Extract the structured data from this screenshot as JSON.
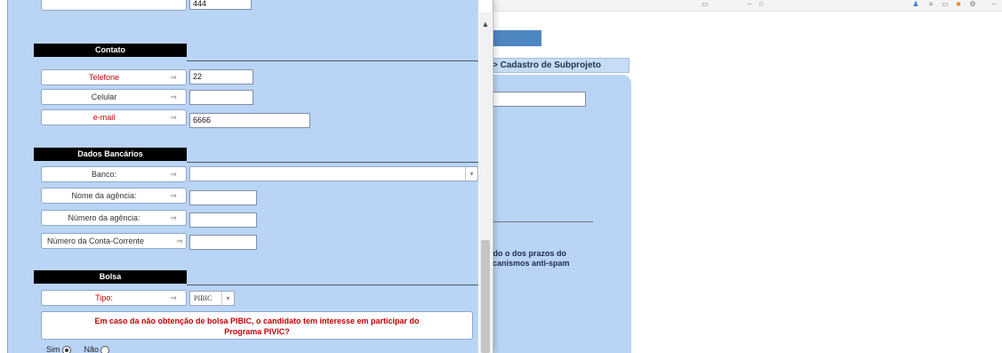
{
  "top_field": {
    "value": "444"
  },
  "contato": {
    "heading": "Contato",
    "fields": [
      {
        "label": "Telefone",
        "arrow": "⇒",
        "value": "22"
      },
      {
        "label": "Celular",
        "arrow": "⇒",
        "value": ""
      },
      {
        "label": "e-mail",
        "arrow": "⇒",
        "value": "6666"
      }
    ]
  },
  "dados_bancarios": {
    "heading": "Dados Bancários",
    "banco": {
      "label": "Banco:",
      "arrow": "⇒",
      "value": ""
    },
    "fields": [
      {
        "label": "Nome da agência:",
        "arrow": "⇒",
        "value": ""
      },
      {
        "label": "Número da agência:",
        "arrow": "⇒",
        "value": ""
      },
      {
        "label": "Número da Conta-Corrente",
        "arrow": "⇒",
        "value": ""
      }
    ]
  },
  "bolsa": {
    "heading": "Bolsa",
    "tipo": {
      "label": "Tipo:",
      "arrow": "⇒",
      "value": "PIBIC"
    },
    "question_line1": "Em caso da não obtenção de bolsa PIBIC, o candidato tem interesse em participar do",
    "question_line2": "Programa PIVIC?",
    "radio_options": [
      {
        "label": "Sim",
        "selected": true
      },
      {
        "label": "Não",
        "selected": false
      }
    ]
  },
  "background_page": {
    "breadcrumb": "> Cadastro de Subprojeto",
    "notice_line1": "ndo o dos prazos do",
    "notice_line2": "ecanismos anti-spam"
  },
  "colors": {
    "form_background": "#b9d4f5",
    "section_header": "#000000",
    "required_label": "#c00000",
    "nav_bar": "#4e86c2"
  }
}
